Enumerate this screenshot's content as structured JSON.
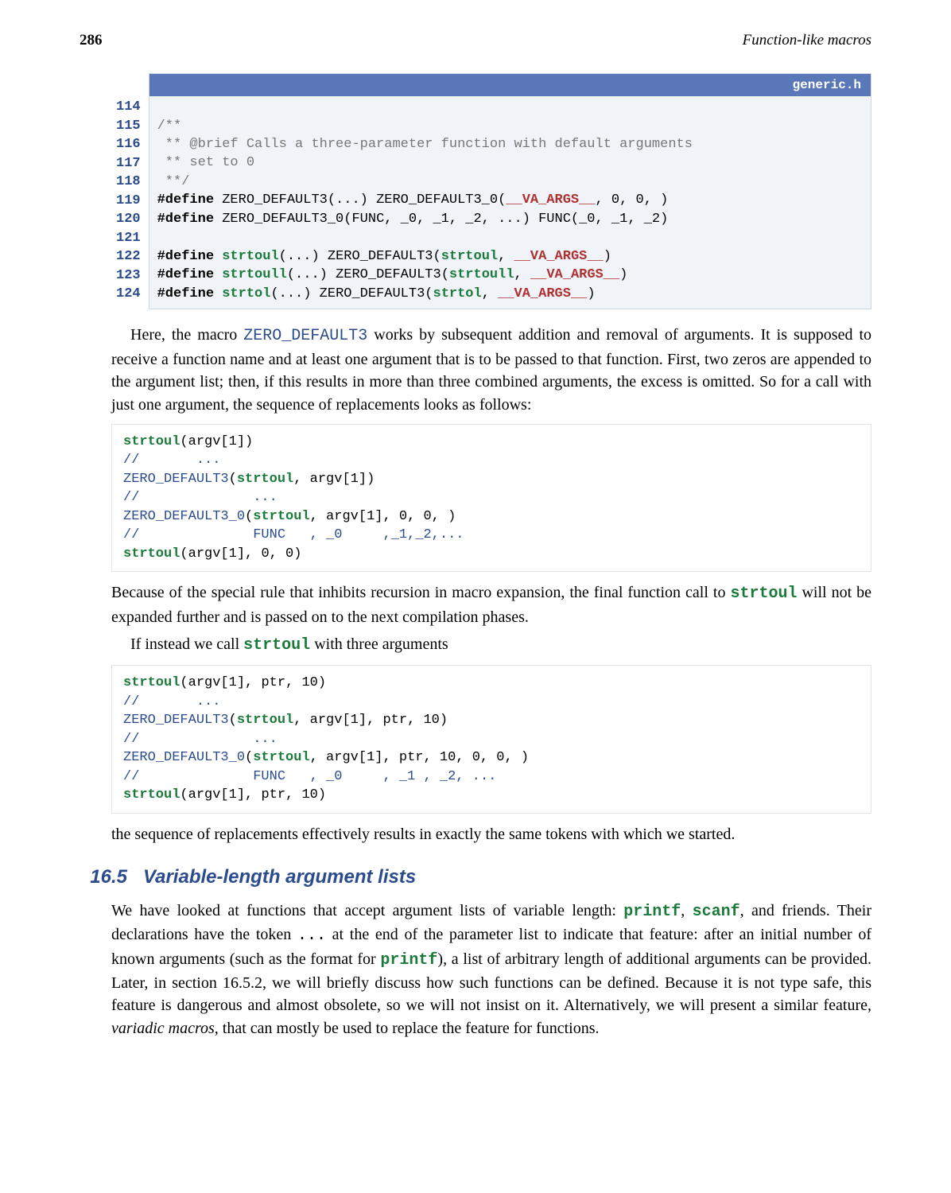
{
  "page": {
    "number": "286",
    "running_title": "Function-like macros"
  },
  "listing": {
    "filename": "generic.h",
    "lines": [
      {
        "n": "114",
        "segments": []
      },
      {
        "n": "115",
        "segments": [
          {
            "cls": "comment",
            "text": "/**"
          }
        ]
      },
      {
        "n": "116",
        "segments": [
          {
            "cls": "comment",
            "text": " ** @brief Calls a three-parameter function with default arguments"
          }
        ]
      },
      {
        "n": "117",
        "segments": [
          {
            "cls": "comment",
            "text": " ** set to 0"
          }
        ]
      },
      {
        "n": "118",
        "segments": [
          {
            "cls": "comment",
            "text": " **/"
          }
        ]
      },
      {
        "n": "119",
        "segments": [
          {
            "cls": "kw-define",
            "text": "#define"
          },
          {
            "cls": "",
            "text": " ZERO_DEFAULT3(...) ZERO_DEFAULT3_0("
          },
          {
            "cls": "kw-va",
            "text": "__VA_ARGS__"
          },
          {
            "cls": "",
            "text": ", 0, 0, )"
          }
        ]
      },
      {
        "n": "120",
        "segments": [
          {
            "cls": "kw-define",
            "text": "#define"
          },
          {
            "cls": "",
            "text": " ZERO_DEFAULT3_0(FUNC, _0, _1, _2, ...) FUNC(_0, _1, _2)"
          }
        ]
      },
      {
        "n": "121",
        "segments": []
      },
      {
        "n": "122",
        "segments": [
          {
            "cls": "kw-define",
            "text": "#define"
          },
          {
            "cls": "",
            "text": " "
          },
          {
            "cls": "kw-green",
            "text": "strtoul"
          },
          {
            "cls": "",
            "text": "(...) ZERO_DEFAULT3("
          },
          {
            "cls": "kw-green",
            "text": "strtoul"
          },
          {
            "cls": "",
            "text": ", "
          },
          {
            "cls": "kw-va",
            "text": "__VA_ARGS__"
          },
          {
            "cls": "",
            "text": ")"
          }
        ]
      },
      {
        "n": "123",
        "segments": [
          {
            "cls": "kw-define",
            "text": "#define"
          },
          {
            "cls": "",
            "text": " "
          },
          {
            "cls": "kw-green",
            "text": "strtoull"
          },
          {
            "cls": "",
            "text": "(...) ZERO_DEFAULT3("
          },
          {
            "cls": "kw-green",
            "text": "strtoull"
          },
          {
            "cls": "",
            "text": ", "
          },
          {
            "cls": "kw-va",
            "text": "__VA_ARGS__"
          },
          {
            "cls": "",
            "text": ")"
          }
        ]
      },
      {
        "n": "124",
        "segments": [
          {
            "cls": "kw-define",
            "text": "#define"
          },
          {
            "cls": "",
            "text": " "
          },
          {
            "cls": "kw-green",
            "text": "strtol"
          },
          {
            "cls": "",
            "text": "(...) ZERO_DEFAULT3("
          },
          {
            "cls": "kw-green",
            "text": "strtol"
          },
          {
            "cls": "",
            "text": ", "
          },
          {
            "cls": "kw-va",
            "text": "__VA_ARGS__"
          },
          {
            "cls": "",
            "text": ")"
          }
        ]
      }
    ]
  },
  "para1": {
    "pre": "Here, the macro ",
    "code1": "ZERO_DEFAULT3",
    "post": " works by subsequent addition and removal of arguments. It is supposed to receive a function name and at least one argument that is to be passed to that function. First, two zeros are appended to the argument list; then, if this results in more than three combined arguments, the excess is omitted. So for a call with just one argument, the sequence of replacements looks as follows:"
  },
  "block1": [
    [
      {
        "cls": "cb-kw",
        "text": "strtoul"
      },
      {
        "cls": "",
        "text": "(argv[1])"
      }
    ],
    [
      {
        "cls": "cb-comm",
        "text": "//       ..."
      }
    ],
    [
      {
        "cls": "cb-blue",
        "text": "ZERO_DEFAULT3"
      },
      {
        "cls": "",
        "text": "("
      },
      {
        "cls": "cb-kw",
        "text": "strtoul"
      },
      {
        "cls": "",
        "text": ", argv[1])"
      }
    ],
    [
      {
        "cls": "cb-comm",
        "text": "//              ..."
      }
    ],
    [
      {
        "cls": "cb-blue",
        "text": "ZERO_DEFAULT3_0"
      },
      {
        "cls": "",
        "text": "("
      },
      {
        "cls": "cb-kw",
        "text": "strtoul"
      },
      {
        "cls": "",
        "text": ", argv[1], 0, 0, )"
      }
    ],
    [
      {
        "cls": "cb-comm",
        "text": "//              FUNC   , _0     ,_1,_2,..."
      }
    ],
    [
      {
        "cls": "cb-kw",
        "text": "strtoul"
      },
      {
        "cls": "",
        "text": "(argv[1], 0, 0)"
      }
    ]
  ],
  "para2": {
    "pre": "Because of the special rule that inhibits recursion in macro expansion, the final function call to ",
    "code1": "strtoul",
    "post": " will not be expanded further and is passed on to the next compilation phases."
  },
  "para3": {
    "pre": "If instead we call ",
    "code1": "strtoul",
    "post": " with three arguments"
  },
  "block2": [
    [
      {
        "cls": "cb-kw",
        "text": "strtoul"
      },
      {
        "cls": "",
        "text": "(argv[1], ptr, 10)"
      }
    ],
    [
      {
        "cls": "cb-comm",
        "text": "//       ..."
      }
    ],
    [
      {
        "cls": "cb-blue",
        "text": "ZERO_DEFAULT3"
      },
      {
        "cls": "",
        "text": "("
      },
      {
        "cls": "cb-kw",
        "text": "strtoul"
      },
      {
        "cls": "",
        "text": ", argv[1], ptr, 10)"
      }
    ],
    [
      {
        "cls": "cb-comm",
        "text": "//              ..."
      }
    ],
    [
      {
        "cls": "cb-blue",
        "text": "ZERO_DEFAULT3_0"
      },
      {
        "cls": "",
        "text": "("
      },
      {
        "cls": "cb-kw",
        "text": "strtoul"
      },
      {
        "cls": "",
        "text": ", argv[1], ptr, 10, 0, 0, )"
      }
    ],
    [
      {
        "cls": "cb-comm",
        "text": "//              FUNC   , _0     , _1 , _2, ..."
      }
    ],
    [
      {
        "cls": "cb-kw",
        "text": "strtoul"
      },
      {
        "cls": "",
        "text": "(argv[1], ptr, 10)"
      }
    ]
  ],
  "para4": "the sequence of replacements effectively results in exactly the same tokens with which we started.",
  "section": {
    "number": "16.5",
    "title": "Variable-length argument lists"
  },
  "para5": {
    "pre": "We have looked at functions that accept argument lists of variable length: ",
    "c1": "printf",
    "t1": ", ",
    "c2": "scanf",
    "t2": ", and friends. Their declarations have the token ",
    "dots": "...",
    "t3": " at the end of the parameter list to indicate that feature: after an initial number of known arguments (such as the format for ",
    "c3": "printf",
    "t4": "), a list of arbitrary length of additional arguments can be provided. Later, in section 16.5.2, we will briefly discuss how such functions can be defined. Because it is not type safe, this feature is dangerous and almost obsolete, so we will not insist on it. Alternatively, we will present a similar feature, ",
    "em": "variadic macros",
    "t5": ", that can mostly be used to replace the feature for functions."
  }
}
